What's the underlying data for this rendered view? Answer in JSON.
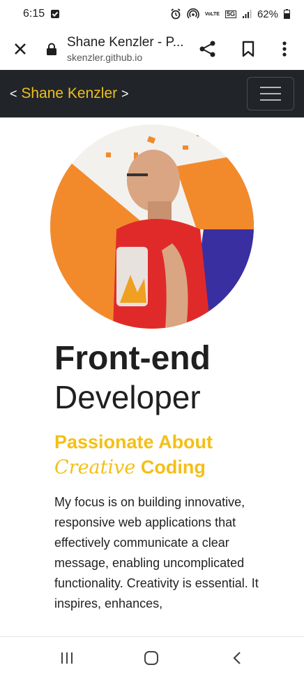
{
  "status_bar": {
    "time": "6:15",
    "network_label_1": "VoLTE",
    "network_label_2": "5G",
    "battery": "62%"
  },
  "browser": {
    "page_title": "Shane Kenzler - P...",
    "domain": "skenzler.github.io"
  },
  "site_nav": {
    "brand_open": "<",
    "brand_name": "Shane Kenzler",
    "brand_close": ">"
  },
  "hero": {
    "title_bold": "Front-end",
    "title_light": "Developer",
    "tagline_line1": "Passionate About",
    "tagline_script": "Creative",
    "tagline_end": " Coding",
    "bio": "My focus is on building innovative, responsive web applications that effectively communicate a clear message, enabling uncomplicated functionality. Creativity is essential. It inspires, enhances,"
  },
  "colors": {
    "accent": "#f4bf16",
    "navbar": "#212529",
    "avatar_orange": "#f28a2b",
    "avatar_blue": "#3a2fa0",
    "shirt_red": "#e02a2a"
  },
  "icons": [
    "close-icon",
    "lock-icon",
    "share-icon",
    "bookmark-icon",
    "more-vert-icon",
    "menu-icon",
    "recents-icon",
    "home-icon",
    "back-icon"
  ]
}
